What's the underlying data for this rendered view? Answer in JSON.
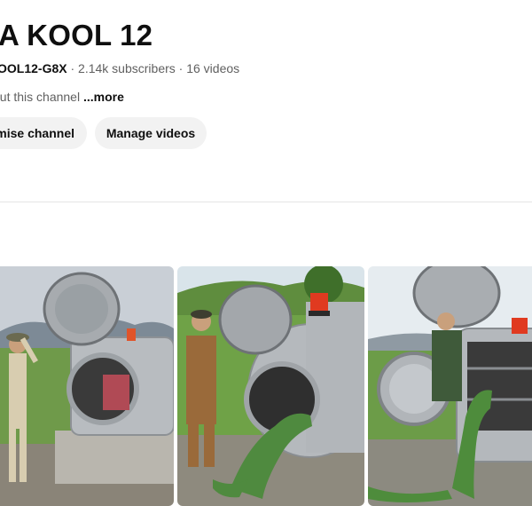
{
  "channel": {
    "name": "A KOOL 12",
    "handle": "OOL12-G8X",
    "subscribers": "2.14k subscribers",
    "separator": "·",
    "videos": "16 videos",
    "about_text": "out this channel",
    "more_label": "...more"
  },
  "buttons": {
    "customise": "mise channel",
    "manage": "Manage videos"
  },
  "colors": {
    "button_bg": "#f2f2f2",
    "text_primary": "#0f0f0f",
    "text_secondary": "#606060",
    "iguana_green": "#3f8a3a"
  },
  "thumbnails": [
    {
      "subject": "man-in-hat-beside-open-steel-tank"
    },
    {
      "subject": "farmer-in-overalls-with-iguana-entering-tank"
    },
    {
      "subject": "man-behind-tank-with-iguana-standing"
    }
  ]
}
